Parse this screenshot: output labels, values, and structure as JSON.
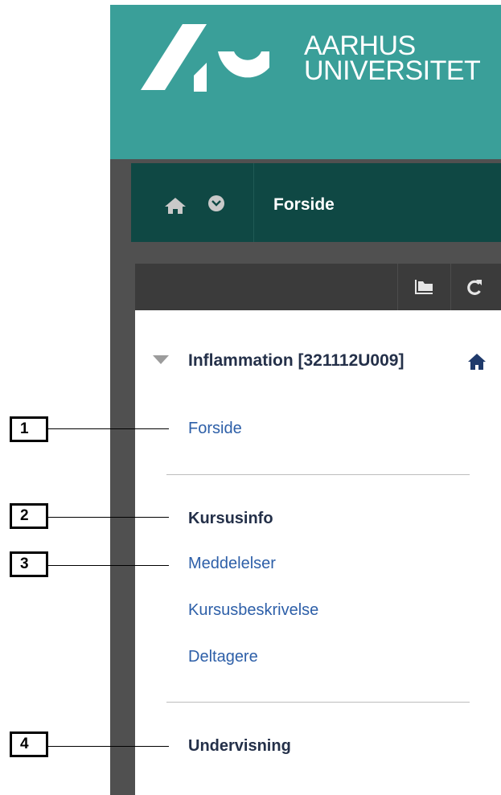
{
  "brand": {
    "line1": "AARHUS",
    "line2": "UNIVERSITET",
    "color": "#3a9f99"
  },
  "navbar": {
    "title": "Forside",
    "home_icon": "home-icon",
    "menu_icon": "chevron-down-circle-icon",
    "color": "#0f4844"
  },
  "toolbar": {
    "icons": [
      "folder-icon",
      "refresh-icon"
    ]
  },
  "course_menu": {
    "course_title": "Inflammation [321112U009]",
    "home_link": "Forside",
    "section1_heading": "Kursusinfo",
    "section1_items": [
      "Meddelelser",
      "Kursusbeskrivelse",
      "Deltagere"
    ],
    "section2_heading": "Undervisning",
    "link_color": "#2d5fa8",
    "heading_color": "#243049"
  },
  "callouts": [
    "1",
    "2",
    "3",
    "4"
  ]
}
